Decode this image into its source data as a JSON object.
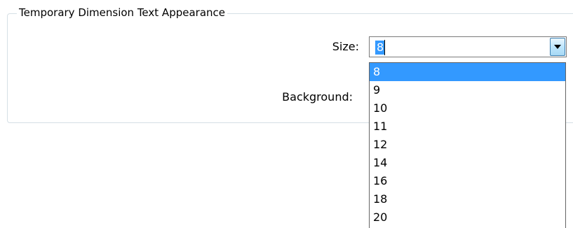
{
  "group": {
    "title": "Temporary Dimension Text Appearance"
  },
  "size_field": {
    "label": "Size:",
    "value": "8",
    "options": [
      "8",
      "9",
      "10",
      "11",
      "12",
      "14",
      "16",
      "18",
      "20"
    ],
    "selected_index": 0
  },
  "background_field": {
    "label": "Background:"
  },
  "icons": {
    "dropdown_arrow": "chevron-down-icon"
  },
  "colors": {
    "selection": "#3399ff",
    "group_border": "#d5dfe5"
  }
}
